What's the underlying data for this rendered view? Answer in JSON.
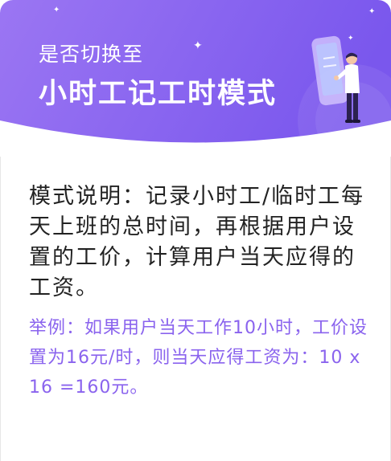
{
  "header": {
    "subtitle": "是否切换至",
    "title": "小时工记工时模式",
    "gradient_start": "#9a73f2",
    "gradient_end": "#7b58ee"
  },
  "illustration": {
    "icon": "person-with-phone-illustration"
  },
  "description": "模式说明：记录小时工/临时工每天上班的总时间，再根据用户设置的工价，计算用户当天应得的工资。",
  "example": "举例：如果用户当天工作10小时，工价设置为16元/时，则当天应得工资为：10 x 16 =160元。",
  "colors": {
    "accent": "#8a63ee",
    "text": "#222222"
  }
}
